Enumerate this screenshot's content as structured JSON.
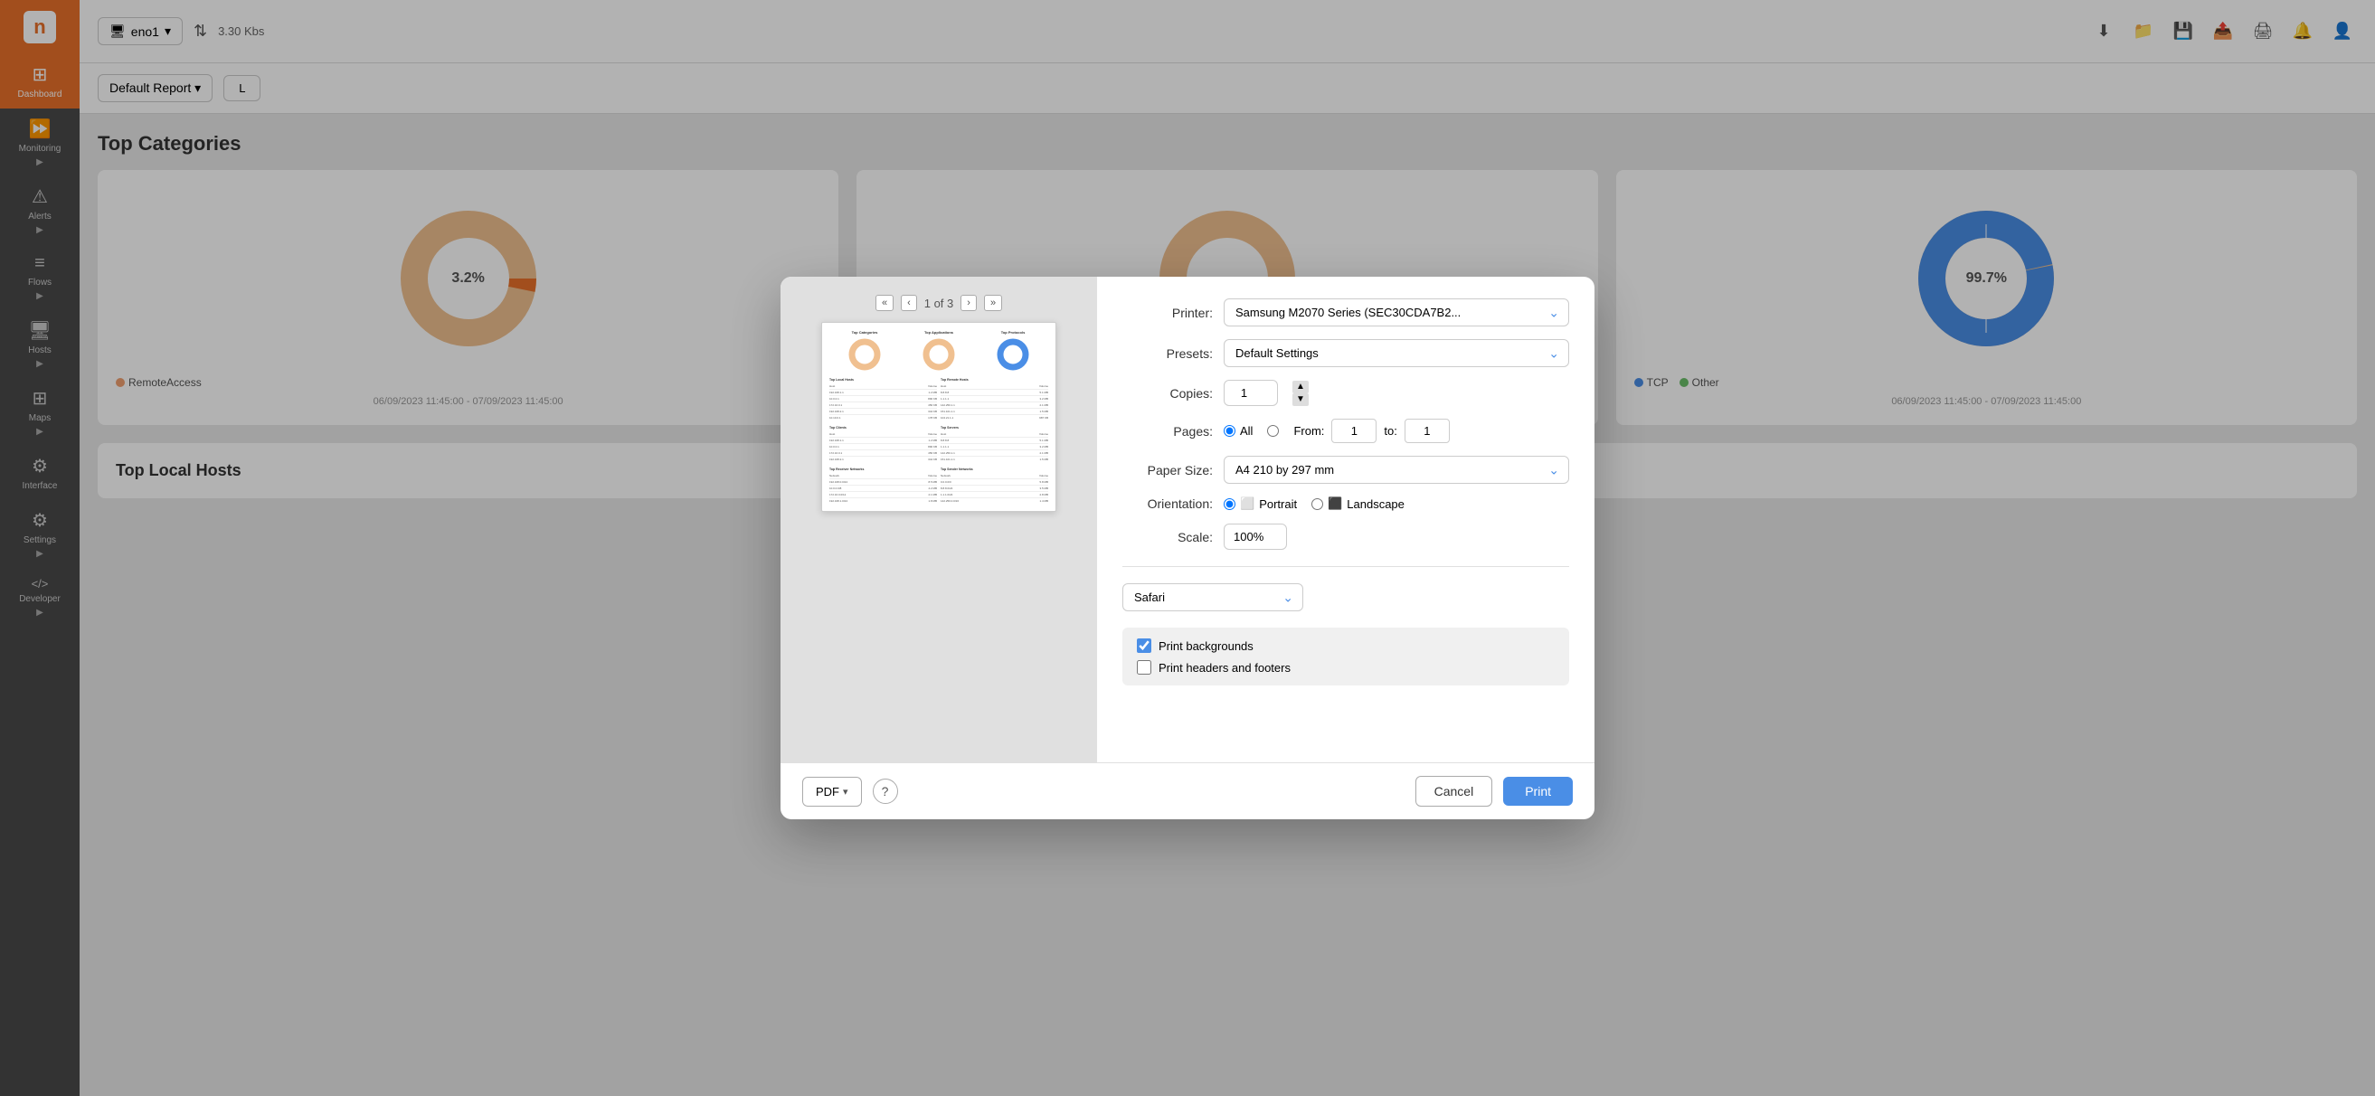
{
  "sidebar": {
    "logo": "n",
    "items": [
      {
        "id": "dashboard",
        "label": "Dashboard",
        "icon": "⊞",
        "active": true
      },
      {
        "id": "monitoring",
        "label": "Monitoring",
        "icon": "⏩"
      },
      {
        "id": "alerts",
        "label": "Alerts",
        "icon": "⚠"
      },
      {
        "id": "flows",
        "label": "Flows",
        "icon": "≡"
      },
      {
        "id": "hosts",
        "label": "Hosts",
        "icon": "🖥"
      },
      {
        "id": "maps",
        "label": "Maps",
        "icon": "⊞"
      },
      {
        "id": "interface",
        "label": "Interface",
        "icon": "⚙"
      },
      {
        "id": "settings",
        "label": "Settings",
        "icon": "⚙"
      },
      {
        "id": "developer",
        "label": "Developer",
        "icon": "</>"
      }
    ]
  },
  "topbar": {
    "interface_select": "eno1",
    "speed_label": "3.30 Kbs",
    "icons": [
      "bell",
      "user"
    ]
  },
  "report_controls": {
    "report_label": "Default Report",
    "live_btn": "L"
  },
  "dashboard": {
    "section_title": "Top Categories",
    "date_range": "06/09/2023 11:45:00 - 07/09/2023 11:45:00",
    "charts": [
      {
        "title": "Top Categories",
        "pct_label": "3.2%",
        "legend": [
          {
            "label": "RemoteAccess",
            "color": "#f0a070"
          }
        ]
      },
      {
        "title": "",
        "pct_label": "99.7%",
        "legend": [
          {
            "label": "TCP",
            "color": "#4a8ee6"
          },
          {
            "label": "Other",
            "color": "#6abf69"
          }
        ]
      }
    ],
    "hosts_section_title": "Top Local Hosts",
    "remote_hosts_title": "Top Remote Hosts"
  },
  "print_dialog": {
    "title": "Print",
    "preview": {
      "nav_first": "«",
      "nav_prev": "‹",
      "nav_next": "›",
      "nav_last": "»",
      "page_count": "1 of 3"
    },
    "printer_label": "Printer:",
    "printer_value": "Samsung M2070 Series (SEC30CDA7B2...",
    "presets_label": "Presets:",
    "presets_value": "Default Settings",
    "copies_label": "Copies:",
    "copies_value": "1",
    "pages_label": "Pages:",
    "pages_all": "All",
    "pages_from": "From:",
    "pages_from_value": "1",
    "pages_to": "to:",
    "pages_to_value": "1",
    "paper_size_label": "Paper Size:",
    "paper_size_value": "A4 210 by 297 mm",
    "orientation_label": "Orientation:",
    "orientation_portrait": "Portrait",
    "orientation_landscape": "Landscape",
    "scale_label": "Scale:",
    "scale_value": "100%",
    "safari_value": "Safari",
    "print_backgrounds_label": "Print backgrounds",
    "print_backgrounds_checked": true,
    "print_headers_footers_label": "Print headers and footers",
    "print_headers_footers_checked": false,
    "pdf_btn": "PDF",
    "cancel_btn": "Cancel",
    "print_btn": "Print"
  }
}
